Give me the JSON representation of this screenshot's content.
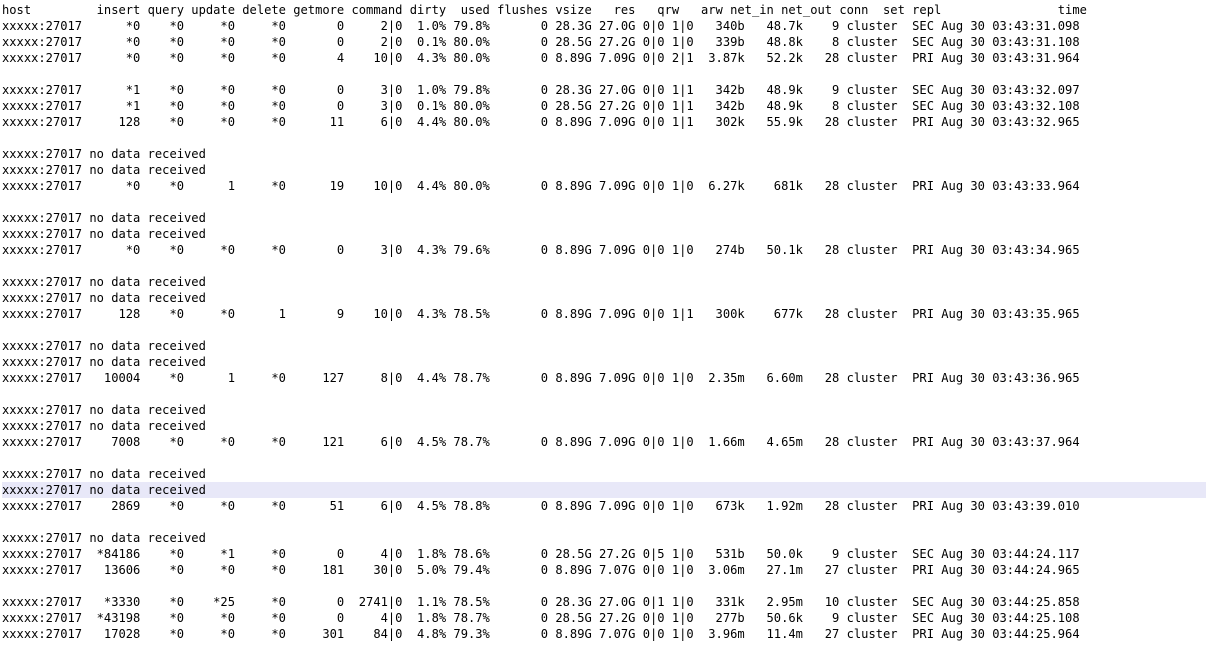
{
  "terminal": {
    "lines": [
      "host         insert query update delete getmore command dirty  used flushes vsize   res   qrw   arw net_in net_out conn  set repl                time",
      "xxxxx:27017      *0    *0     *0     *0       0     2|0  1.0% 79.8%       0 28.3G 27.0G 0|0 1|0   340b   48.7k    9 cluster  SEC Aug 30 03:43:31.098",
      "xxxxx:27017      *0    *0     *0     *0       0     2|0  0.1% 80.0%       0 28.5G 27.2G 0|0 1|0   339b   48.8k    8 cluster  SEC Aug 30 03:43:31.108",
      "xxxxx:27017      *0    *0     *0     *0       4    10|0  4.3% 80.0%       0 8.89G 7.09G 0|0 2|1  3.87k   52.2k   28 cluster  PRI Aug 30 03:43:31.964",
      "",
      "xxxxx:27017      *1    *0     *0     *0       0     3|0  1.0% 79.8%       0 28.3G 27.0G 0|0 1|1   342b   48.9k    9 cluster  SEC Aug 30 03:43:32.097",
      "xxxxx:27017      *1    *0     *0     *0       0     3|0  0.1% 80.0%       0 28.5G 27.2G 0|0 1|1   342b   48.9k    8 cluster  SEC Aug 30 03:43:32.108",
      "xxxxx:27017     128    *0     *0     *0      11     6|0  4.4% 80.0%       0 8.89G 7.09G 0|0 1|1   302k   55.9k   28 cluster  PRI Aug 30 03:43:32.965",
      "",
      "xxxxx:27017 no data received",
      "xxxxx:27017 no data received",
      "xxxxx:27017      *0    *0      1     *0      19    10|0  4.4% 80.0%       0 8.89G 7.09G 0|0 1|0  6.27k    681k   28 cluster  PRI Aug 30 03:43:33.964",
      "",
      "xxxxx:27017 no data received",
      "xxxxx:27017 no data received",
      "xxxxx:27017      *0    *0     *0     *0       0     3|0  4.3% 79.6%       0 8.89G 7.09G 0|0 1|0   274b   50.1k   28 cluster  PRI Aug 30 03:43:34.965",
      "",
      "xxxxx:27017 no data received",
      "xxxxx:27017 no data received",
      "xxxxx:27017     128    *0     *0      1       9    10|0  4.3% 78.5%       0 8.89G 7.09G 0|0 1|1   300k    677k   28 cluster  PRI Aug 30 03:43:35.965",
      "",
      "xxxxx:27017 no data received",
      "xxxxx:27017 no data received",
      "xxxxx:27017   10004    *0      1     *0     127     8|0  4.4% 78.7%       0 8.89G 7.09G 0|0 1|0  2.35m   6.60m   28 cluster  PRI Aug 30 03:43:36.965",
      "",
      "xxxxx:27017 no data received",
      "xxxxx:27017 no data received",
      "xxxxx:27017    7008    *0     *0     *0     121     6|0  4.5% 78.7%       0 8.89G 7.09G 0|0 1|0  1.66m   4.65m   28 cluster  PRI Aug 30 03:43:37.964",
      "",
      "xxxxx:27017 no data received",
      "xxxxx:27017 no data received",
      "xxxxx:27017    2869    *0     *0     *0      51     6|0  4.5% 78.8%       0 8.89G 7.09G 0|0 1|0   673k   1.92m   28 cluster  PRI Aug 30 03:43:39.010",
      "",
      "xxxxx:27017 no data received",
      "xxxxx:27017  *84186    *0     *1     *0       0     4|0  1.8% 78.6%       0 28.5G 27.2G 0|5 1|0   531b   50.0k    9 cluster  SEC Aug 30 03:44:24.117",
      "xxxxx:27017   13606    *0     *0     *0     181    30|0  5.0% 79.4%       0 8.89G 7.07G 0|0 1|0  3.06m   27.1m   27 cluster  PRI Aug 30 03:44:24.965",
      "",
      "xxxxx:27017   *3330    *0    *25     *0       0  2741|0  1.1% 78.5%       0 28.3G 27.0G 0|1 1|0   331k   2.95m   10 cluster  SEC Aug 30 03:44:25.858",
      "xxxxx:27017  *43198    *0     *0     *0       0     4|0  1.8% 78.7%       0 28.5G 27.2G 0|0 1|0   277b   50.6k    9 cluster  SEC Aug 30 03:44:25.108",
      "xxxxx:27017   17028    *0     *0     *0     301    84|0  4.8% 79.3%       0 8.89G 7.07G 0|0 1|0  3.96m   11.4m   27 cluster  PRI Aug 30 03:44:25.964"
    ],
    "highlight_line": 30,
    "highlight_color": "#e8e8f8",
    "text_color": "#000000",
    "background_color": "#ffffff"
  }
}
